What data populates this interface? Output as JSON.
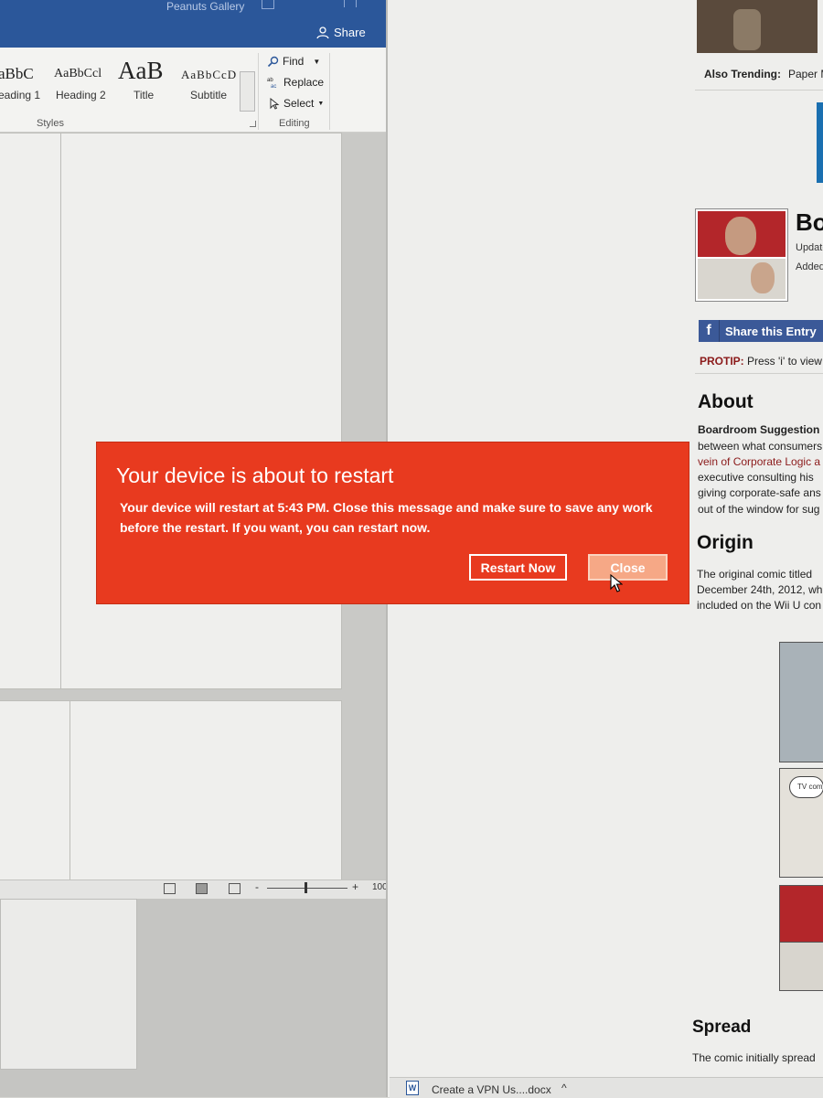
{
  "word": {
    "doc_title": "Peanuts Gallery",
    "share_label": "Share",
    "styles": [
      {
        "sample": "aBbC",
        "label": "eading 1"
      },
      {
        "sample": "AaBbCcl",
        "label": "Heading 2"
      },
      {
        "sample": "AaB",
        "label": "Title"
      },
      {
        "sample": "AaBbCcD",
        "label": "Subtitle"
      }
    ],
    "styles_group": "Styles",
    "editing": {
      "find": "Find",
      "replace": "Replace",
      "select": "Select",
      "group": "Editing"
    },
    "status": {
      "zoom_minus": "-",
      "zoom_plus": "+",
      "zoom_level": "100"
    }
  },
  "browser": {
    "trending_label": "Also Trending:",
    "trending_item": "Paper M",
    "entry_title": "Bo",
    "entry_updated": "Update",
    "entry_added": "Added",
    "share_entry": "Share this Entry",
    "protip_label": "PROTIP:",
    "protip_text": " Press 'i' to view t",
    "about_heading": "About",
    "about_lines": [
      "Boardroom Suggestion",
      "between what consumers",
      "vein of Corporate Logic a",
      "executive consulting his",
      "giving corporate-safe ans",
      "out of the window for sug"
    ],
    "origin_heading": "Origin",
    "origin_lines": [
      "The original comic titled",
      "December 24th, 2012, wh",
      "included on the Wii U con"
    ],
    "comic_bubble_text": "TV com",
    "spread_heading": "Spread",
    "spread_line": "The comic initially spread",
    "download_name": "Create a VPN Us....docx",
    "download_chevron": "^"
  },
  "toast": {
    "title": "Your device is about to restart",
    "body": "Your device will restart at 5:43 PM. Close this message and make sure to save any work before the restart. If you want, you can restart now.",
    "restart_label": "Restart Now",
    "close_label": "Close",
    "bg_color": "#e83a1f"
  }
}
